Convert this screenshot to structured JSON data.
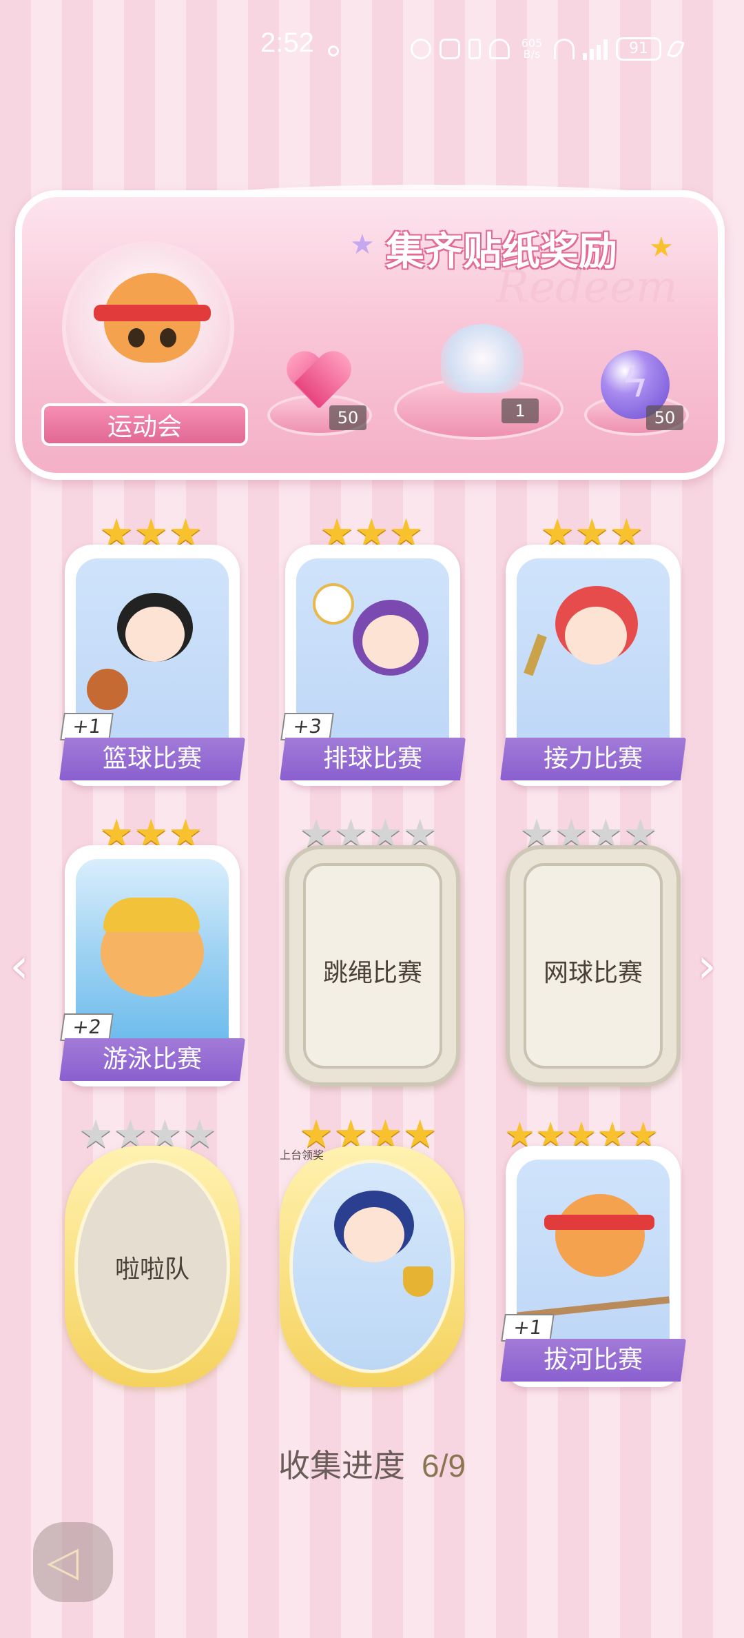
{
  "status_bar": {
    "time": "2:52",
    "net_speed": "605\nB/s",
    "battery": "91",
    "icons": [
      "nfc-icon",
      "bluetooth-icon",
      "mute-icon",
      "wifi-icon",
      "signal-icon"
    ]
  },
  "banner": {
    "title": "集齐贴纸奖励",
    "watermark": "Redeem",
    "event_name": "运动会",
    "rewards": [
      {
        "icon": "pink-heart-gem-icon",
        "count": "50"
      },
      {
        "icon": "jellyfish-icon",
        "count": "1"
      },
      {
        "icon": "lightning-orb-icon",
        "count": "50"
      }
    ]
  },
  "stickers": [
    {
      "name": "篮球比赛",
      "stars_gold": 3,
      "stars_total": 3,
      "state": "unlocked",
      "extra": "+1"
    },
    {
      "name": "排球比赛",
      "stars_gold": 3,
      "stars_total": 3,
      "state": "unlocked",
      "extra": "+3"
    },
    {
      "name": "接力比赛",
      "stars_gold": 3,
      "stars_total": 3,
      "state": "unlocked",
      "extra": ""
    },
    {
      "name": "游泳比赛",
      "stars_gold": 3,
      "stars_total": 3,
      "state": "unlocked",
      "extra": "+2"
    },
    {
      "name": "跳绳比赛",
      "stars_gold": 0,
      "stars_total": 4,
      "state": "locked",
      "extra": ""
    },
    {
      "name": "网球比赛",
      "stars_gold": 0,
      "stars_total": 4,
      "state": "locked",
      "extra": ""
    },
    {
      "name": "啦啦队",
      "stars_gold": 0,
      "stars_total": 4,
      "state": "locked",
      "extra": ""
    },
    {
      "name": "上台领奖",
      "stars_gold": 4,
      "stars_total": 4,
      "state": "unlocked",
      "extra": ""
    },
    {
      "name": "拔河比赛",
      "stars_gold": 5,
      "stars_total": 5,
      "state": "unlocked",
      "extra": "+1"
    }
  ],
  "progress": {
    "label": "收集进度",
    "value": "6/9"
  },
  "nav": {
    "prev_icon": "chevron-left-icon",
    "next_icon": "chevron-right-icon",
    "back_icon": "back-arrow-icon"
  }
}
